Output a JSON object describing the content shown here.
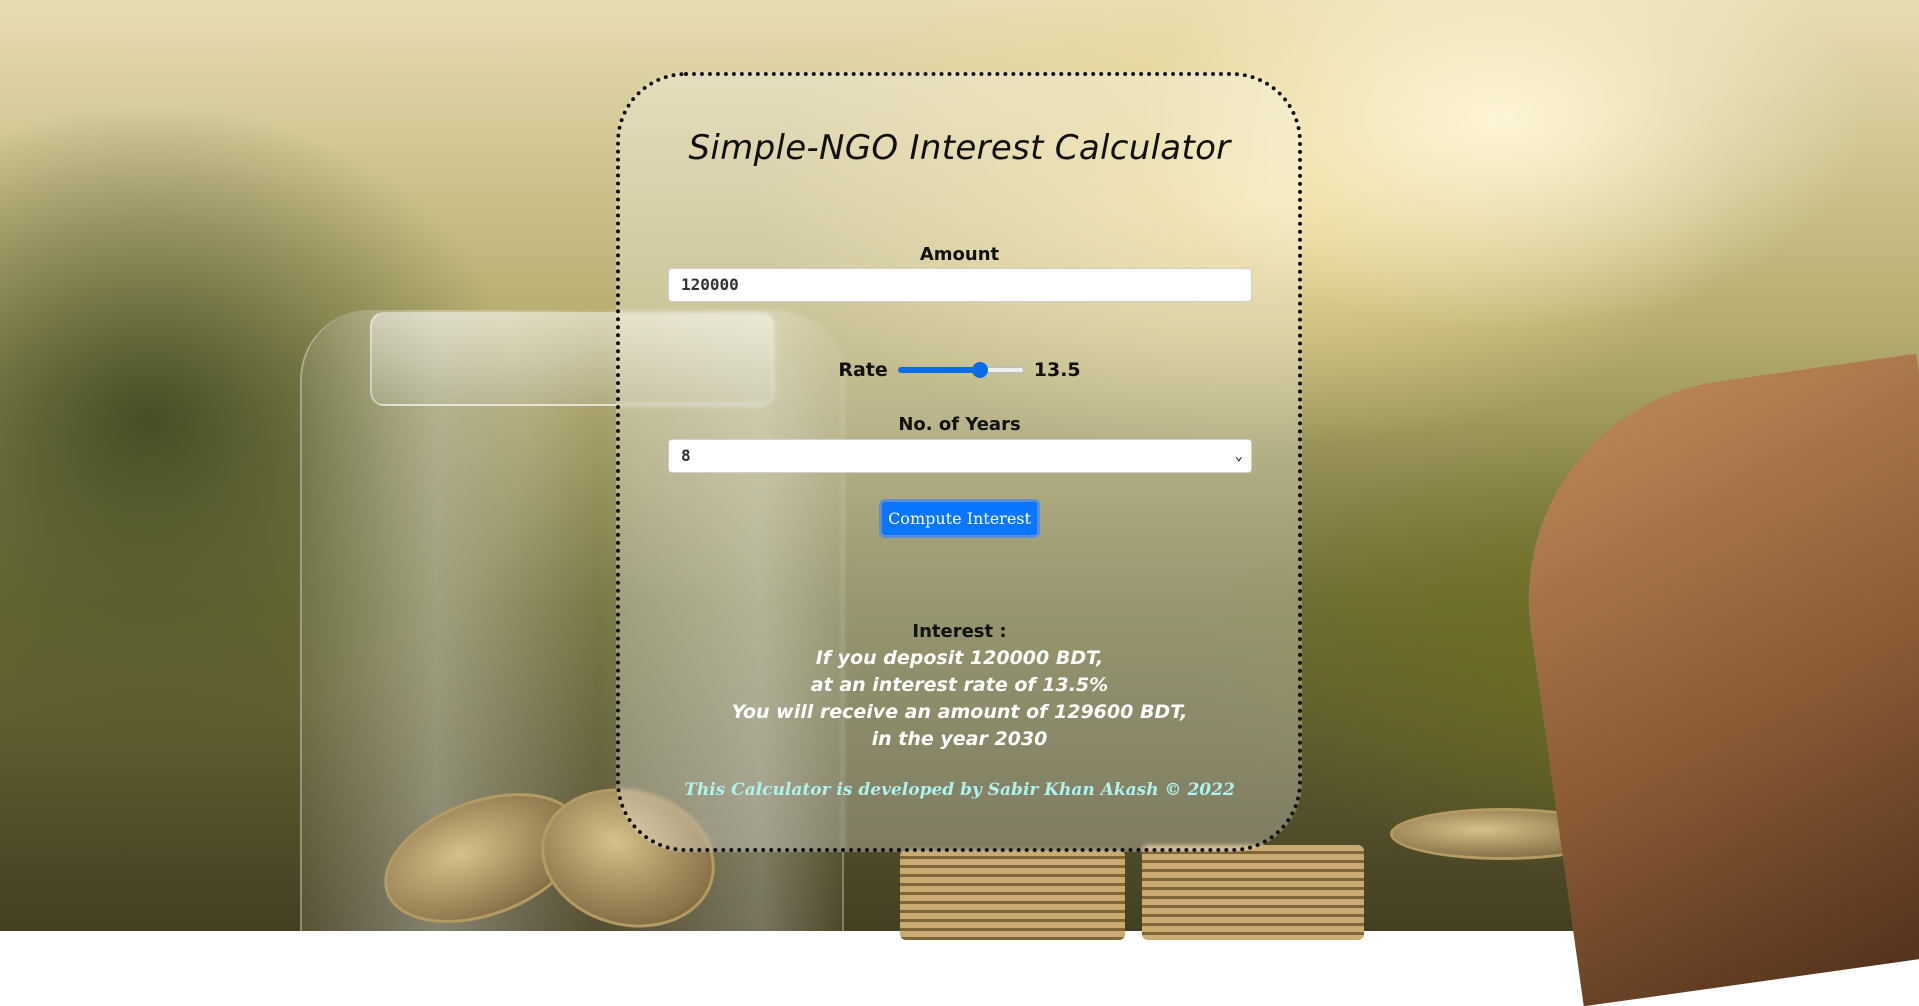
{
  "page": {
    "title": "Simple-NGO Interest Calculator"
  },
  "amount": {
    "label": "Amount",
    "value": "120000"
  },
  "rate": {
    "label": "Rate",
    "value": "13.5",
    "slider_fraction": 0.65
  },
  "years": {
    "label": "No. of Years",
    "selected": "8"
  },
  "button": {
    "compute_label": "Compute Interest"
  },
  "result": {
    "heading": "Interest :",
    "line1": "If you deposit 120000 BDT,",
    "line2": "at an interest rate of 13.5%",
    "line3": "You will receive an amount of 129600 BDT,",
    "line4": "in the year 2030"
  },
  "footer": {
    "credit": "This Calculator is developed by Sabir Khan Akash © 2022"
  },
  "colors": {
    "accent": "#0a75ff",
    "footer_text": "#aef3ee"
  }
}
